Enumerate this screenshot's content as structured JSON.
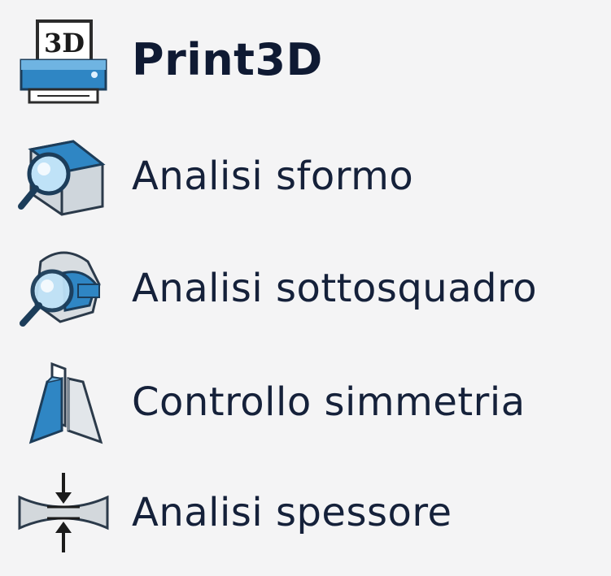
{
  "menu": {
    "items": [
      {
        "label": "Print3D",
        "icon": "printer-3d-icon",
        "bold": true
      },
      {
        "label": "Analisi sformo",
        "icon": "draft-analysis-icon"
      },
      {
        "label": "Analisi sottosquadro",
        "icon": "undercut-analysis-icon"
      },
      {
        "label": "Controllo simmetria",
        "icon": "symmetry-check-icon"
      },
      {
        "label": "Analisi spessore",
        "icon": "thickness-analysis-icon"
      }
    ],
    "print3d_badge": "3D"
  },
  "colors": {
    "background": "#f4f4f5",
    "text": "#15213a",
    "icon_blue": "#2f86c4",
    "icon_dark": "#1c3d5a"
  }
}
